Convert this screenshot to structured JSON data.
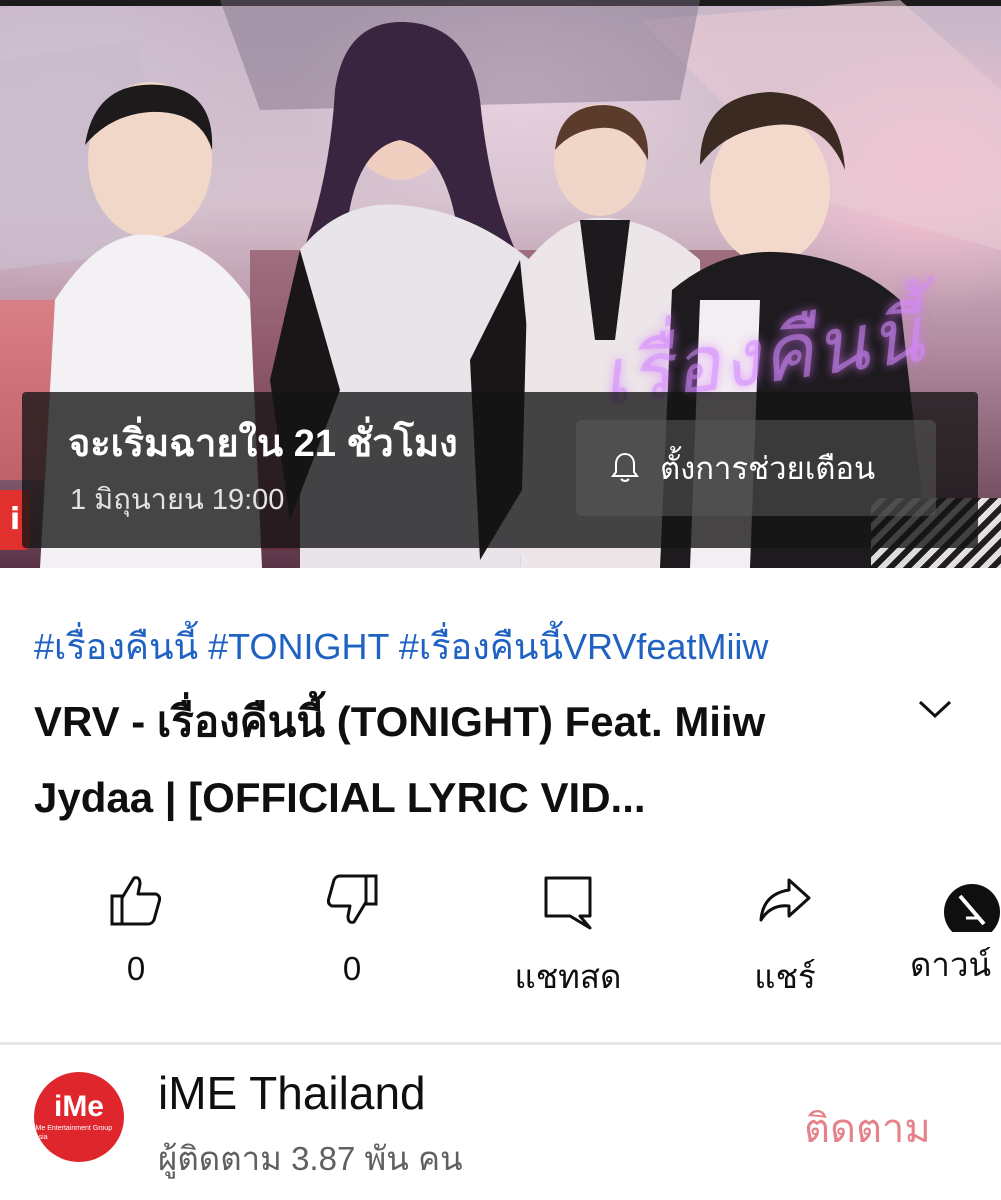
{
  "video": {
    "premiere_title": "จะเริ่มฉายใน 21 ชั่วโมง",
    "premiere_datetime": "1 มิถุนายน 19:00",
    "reminder_label": "ตั้งการช่วยเตือน",
    "logo_text": "iMe",
    "logo_caption": "iMe Entertainment Group Asia"
  },
  "details": {
    "hashtags": "#เรื่องคืนนี้ #TONIGHT #เรื่องคืนนี้VRVfeatMiiw",
    "title": "VRV - เรื่องคืนนี้ (TONIGHT) Feat. Miiw Jydaa | [OFFICIAL LYRIC VID..."
  },
  "actions": {
    "like_count": "0",
    "dislike_count": "0",
    "live_chat_label": "แชทสด",
    "share_label": "แชร์",
    "download_label": "ดาวน์"
  },
  "channel": {
    "name": "iME Thailand",
    "subscribers": "ผู้ติดตาม 3.87 พัน คน",
    "subscribe_label": "ติดตาม",
    "avatar_text": "iMe",
    "avatar_caption": "iMe Entertainment Group Asia"
  }
}
